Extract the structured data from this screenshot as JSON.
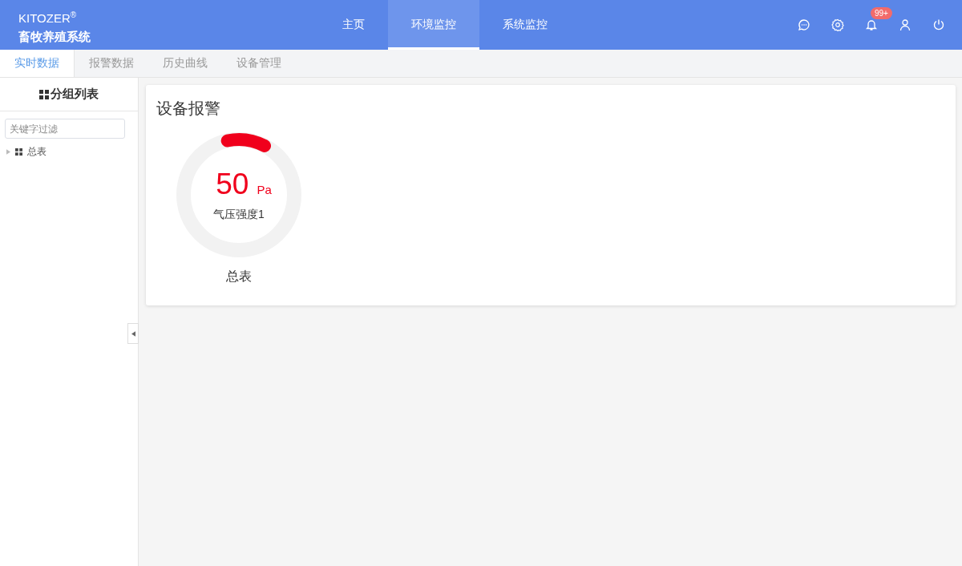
{
  "header": {
    "brand": "KITOZER",
    "brand_mark": "®",
    "system_name": "畜牧养殖系统",
    "nav": [
      {
        "label": "主页",
        "selected": false
      },
      {
        "label": "环境监控",
        "selected": true
      },
      {
        "label": "系统监控",
        "selected": false
      }
    ],
    "notification_badge": "99+"
  },
  "tabs": [
    {
      "label": "实时数据",
      "selected": true
    },
    {
      "label": "报警数据",
      "selected": false
    },
    {
      "label": "历史曲线",
      "selected": false
    },
    {
      "label": "设备管理",
      "selected": false
    }
  ],
  "sidebar": {
    "title": "分组列表",
    "filter": {
      "placeholder": "关键字过滤"
    },
    "tree": [
      {
        "label": "总表",
        "expanded": false
      }
    ]
  },
  "card": {
    "title": "设备报警",
    "gauges": [
      {
        "value": "50",
        "unit": "Pa",
        "name": "气压强度1",
        "group": "总表",
        "level": 0.11,
        "color": "#f0001c"
      }
    ]
  }
}
